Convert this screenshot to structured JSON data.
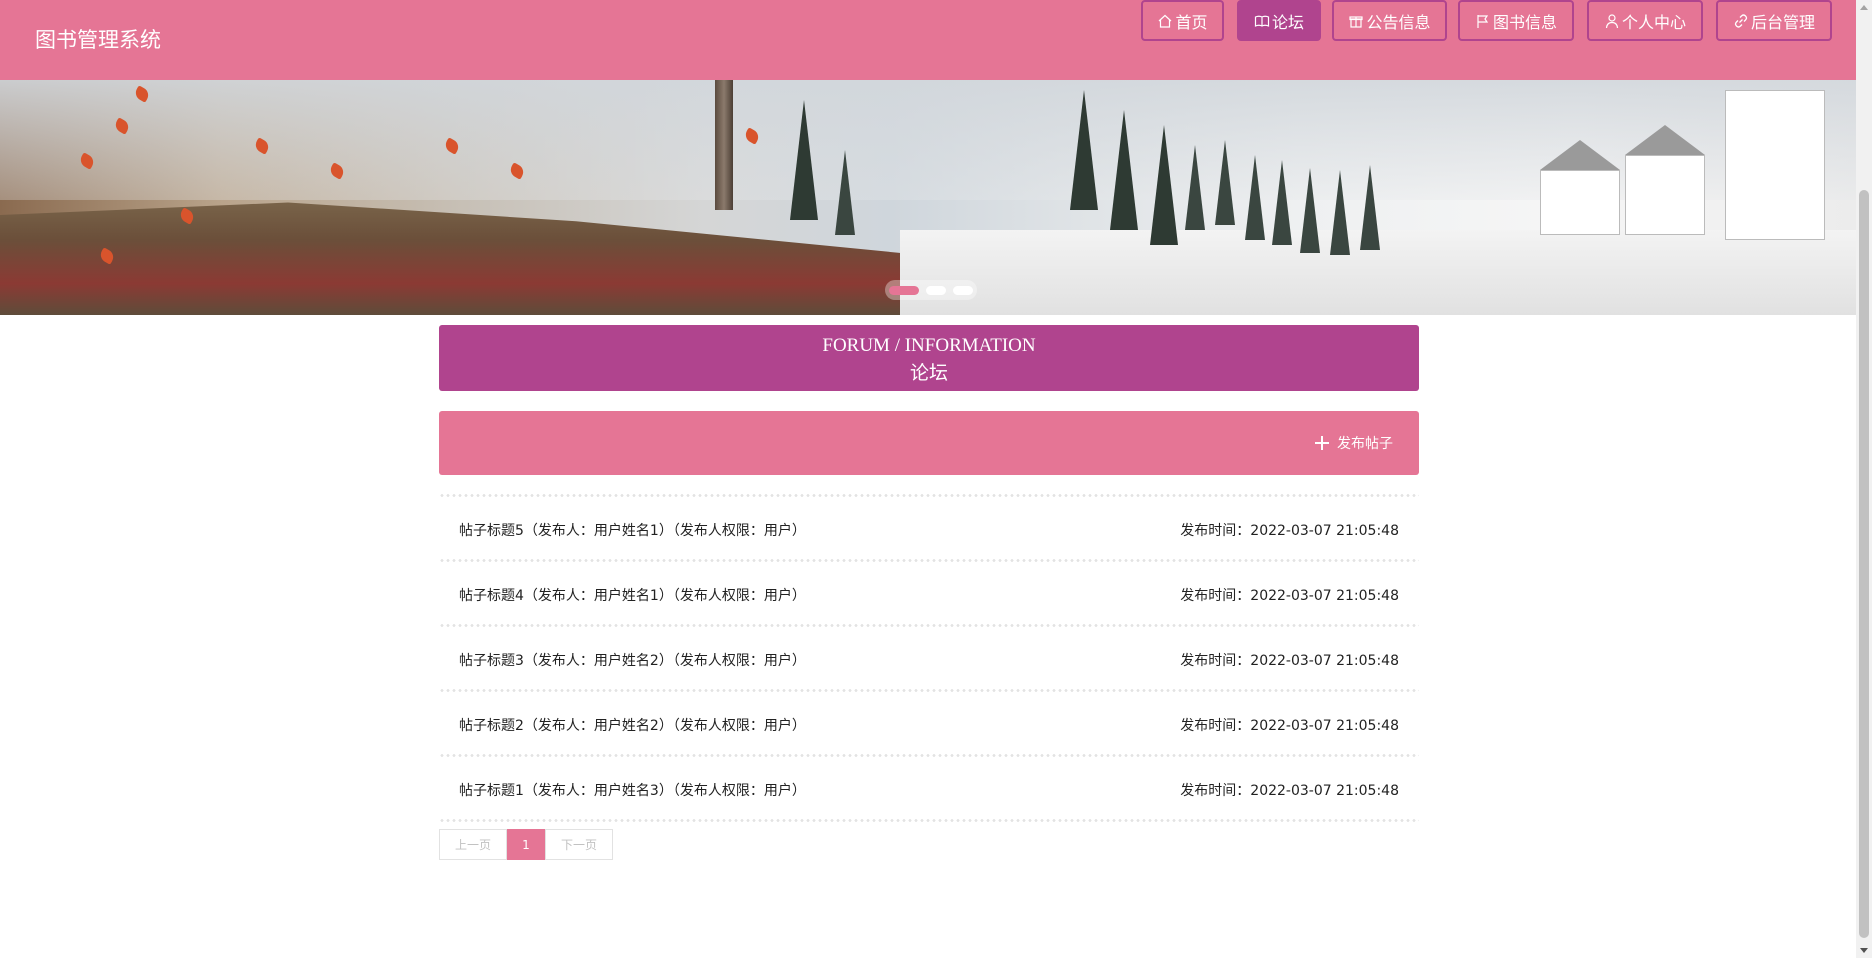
{
  "header": {
    "brand": "图书管理系统",
    "nav": [
      {
        "label": "首页",
        "icon": "home-icon"
      },
      {
        "label": "论坛",
        "icon": "book-open-icon",
        "active": true
      },
      {
        "label": "公告信息",
        "icon": "gift-icon"
      },
      {
        "label": "图书信息",
        "icon": "flag-icon"
      },
      {
        "label": "个人中心",
        "icon": "user-icon"
      },
      {
        "label": "后台管理",
        "icon": "link-icon"
      }
    ]
  },
  "banner": {
    "slides": 3,
    "active_slide": 1
  },
  "section": {
    "title_en": "FORUM / INFORMATION",
    "title_cn": "论坛"
  },
  "actions": {
    "post_label": "发布帖子"
  },
  "posts": [
    {
      "title": "帖子标题5（发布人：用户姓名1）（发布人权限：用户）",
      "date": "发布时间：2022-03-07 21:05:48"
    },
    {
      "title": "帖子标题4（发布人：用户姓名1）（发布人权限：用户）",
      "date": "发布时间：2022-03-07 21:05:48"
    },
    {
      "title": "帖子标题3（发布人：用户姓名2）（发布人权限：用户）",
      "date": "发布时间：2022-03-07 21:05:48"
    },
    {
      "title": "帖子标题2（发布人：用户姓名2）（发布人权限：用户）",
      "date": "发布时间：2022-03-07 21:05:48"
    },
    {
      "title": "帖子标题1（发布人：用户姓名3）（发布人权限：用户）",
      "date": "发布时间：2022-03-07 21:05:48"
    }
  ],
  "pagination": {
    "prev": "上一页",
    "current": "1",
    "next": "下一页"
  },
  "colors": {
    "primary": "#e57595",
    "accent": "#b0448e"
  }
}
